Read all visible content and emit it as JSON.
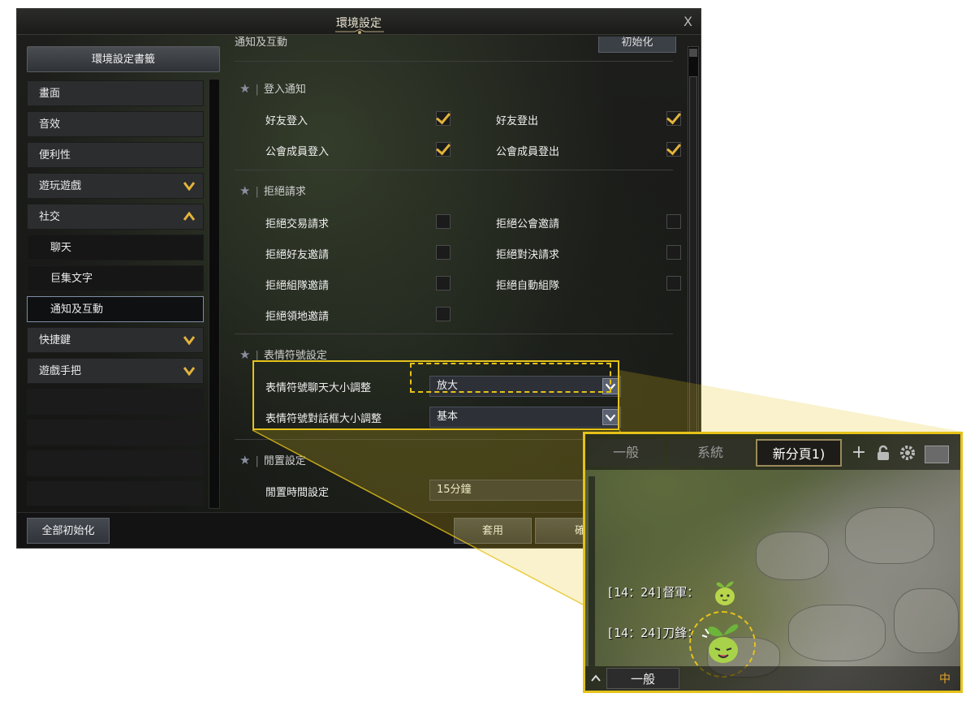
{
  "window": {
    "title": "環境設定",
    "close": "X"
  },
  "sidebar": {
    "header": "環境設定書籤",
    "items": [
      {
        "label": "畫面"
      },
      {
        "label": "音效"
      },
      {
        "label": "便利性"
      },
      {
        "label": "遊玩遊戲"
      },
      {
        "label": "社交"
      },
      {
        "label": "聊天"
      },
      {
        "label": "巨集文字"
      },
      {
        "label": "通知及互動"
      },
      {
        "label": "快捷鍵"
      },
      {
        "label": "遊戲手把"
      }
    ]
  },
  "content": {
    "cut_heading": "通知及互動",
    "reset_button": "初始化",
    "sections": {
      "login": {
        "title": "登入通知",
        "options": [
          {
            "label": "好友登入",
            "checked": true
          },
          {
            "label": "好友登出",
            "checked": true
          },
          {
            "label": "公會成員登入",
            "checked": true
          },
          {
            "label": "公會成員登出",
            "checked": true
          }
        ]
      },
      "reject": {
        "title": "拒絕請求",
        "options": [
          {
            "label": "拒絕交易請求",
            "checked": false
          },
          {
            "label": "拒絕公會邀請",
            "checked": false
          },
          {
            "label": "拒絕好友邀請",
            "checked": false
          },
          {
            "label": "拒絕對決請求",
            "checked": false
          },
          {
            "label": "拒絕組隊邀請",
            "checked": false
          },
          {
            "label": "拒絕自動組隊",
            "checked": false
          },
          {
            "label": "拒絕領地邀請",
            "checked": false
          }
        ]
      },
      "emoticon": {
        "title": "表情符號設定",
        "options": [
          {
            "label": "表情符號聊天大小調整",
            "value": "放大"
          },
          {
            "label": "表情符號對話框大小調整",
            "value": "基本"
          }
        ]
      },
      "idle": {
        "title": "閒置設定",
        "options": [
          {
            "label": "閒置時間設定",
            "value": "15分鐘"
          }
        ]
      }
    }
  },
  "footer": {
    "reset_all": "全部初始化",
    "apply": "套用",
    "confirm": "確認"
  },
  "zoom": {
    "tabs": [
      {
        "label": "一般"
      },
      {
        "label": "系統"
      },
      {
        "label": "新分頁1)"
      }
    ],
    "add_tab": "+",
    "messages": [
      "[14：24]督軍：",
      "[14：24]刀鋒："
    ],
    "bottom_channel": "一般",
    "bottom_ime": "中"
  },
  "colors": {
    "highlight": "#e5c21a",
    "checkmark": "#e2b33c",
    "background": "#141414"
  }
}
